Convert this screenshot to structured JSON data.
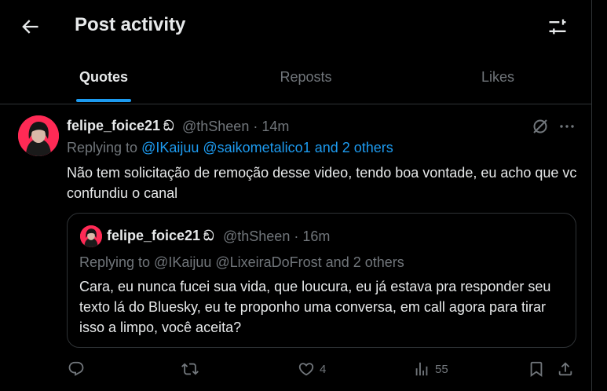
{
  "header": {
    "title": "Post activity",
    "back_icon": "arrow-left-icon",
    "filter_icon": "sliders-icon"
  },
  "tabs": [
    {
      "label": "Quotes",
      "active": true
    },
    {
      "label": "Reposts",
      "active": false
    },
    {
      "label": "Likes",
      "active": false
    }
  ],
  "post": {
    "display_name": "felipe_foice21",
    "badge": "ඞ",
    "handle": "@thSheen",
    "time": "· 14m",
    "replying_prefix": "Replying to ",
    "replying_links": "@IKaijuu @saikometalico1 and 2 others",
    "text": "Não tem solicitação de remoção desse video, tendo boa vontade, eu acho que vc confundiu o canal",
    "quote": {
      "display_name": "felipe_foice21",
      "badge": "ඞ",
      "handle": "@thSheen",
      "time": "· 16m",
      "replying": "Replying to @IKaijuu @LixeiraDoFrost and 2 others",
      "text": "Cara, eu nunca fucei sua vida, que loucura, eu já estava pra responder seu texto lá do Bluesky, eu te proponho uma conversa, em call agora para tirar isso a limpo, você aceita?"
    },
    "actions": {
      "reply_count": "",
      "repost_count": "",
      "like_count": "4",
      "views_count": "55"
    }
  },
  "colors": {
    "accent": "#1d9bf0",
    "muted": "#71767b",
    "text": "#e7e9ea",
    "border": "#2f3336",
    "avatar": "#ff2a55"
  }
}
